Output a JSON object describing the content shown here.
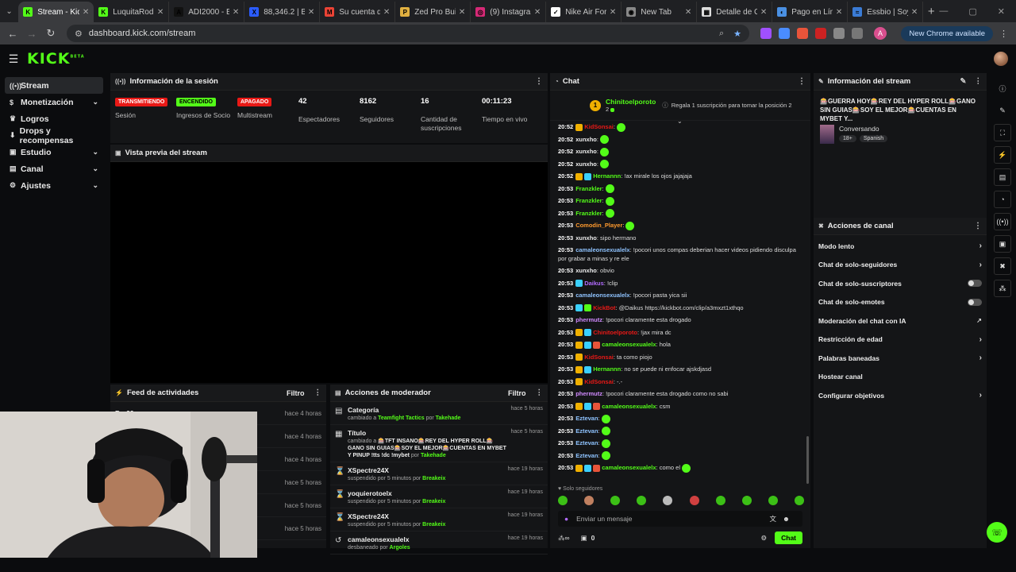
{
  "browser": {
    "tabs": [
      {
        "title": "Stream - Kick",
        "favicon": "#53fc18",
        "letter": "K",
        "active": true
      },
      {
        "title": "LuquitaRodri",
        "favicon": "#53fc18",
        "letter": "K"
      },
      {
        "title": "ADI2000 - BIN",
        "favicon": "#111111",
        "letter": "A"
      },
      {
        "title": "88,346.2 | BTC",
        "favicon": "#2b5cff",
        "letter": "X"
      },
      {
        "title": "Su cuenta de G",
        "favicon": "#ea4335",
        "letter": "M"
      },
      {
        "title": "Zed Pro Build",
        "favicon": "#e0b040",
        "letter": "P"
      },
      {
        "title": "(9) Instagram",
        "favicon": "#d62976",
        "letter": "◎"
      },
      {
        "title": "Nike Air Force",
        "favicon": "#ffffff",
        "letter": "✓"
      },
      {
        "title": "New Tab",
        "favicon": "#888888",
        "letter": "◉"
      },
      {
        "title": "Detalle de C",
        "favicon": "#dddddd",
        "letter": "▦"
      },
      {
        "title": "Pago en Línea",
        "favicon": "#4a90e2",
        "letter": "◐"
      },
      {
        "title": "Essbio | Soy",
        "favicon": "#3a7bd5",
        "letter": "≈"
      }
    ],
    "url": "dashboard.kick.com/stream",
    "new_chrome": "New Chrome available",
    "ext_colors": [
      "#a050ff",
      "#4a8cff",
      "#e8543a",
      "#cc2222",
      "#888888",
      "#777777"
    ],
    "profile_letter": "A"
  },
  "brand": {
    "logo": "KICK",
    "logo_sup": "BETA"
  },
  "sidebar": {
    "items": [
      {
        "label": "Stream",
        "icon": "((•))",
        "active": true,
        "chevron": false
      },
      {
        "label": "Monetización",
        "icon": "$",
        "chevron": true
      },
      {
        "label": "Logros",
        "icon": "♛",
        "chevron": false
      },
      {
        "label": "Drops y recompensas",
        "icon": "⬇",
        "chevron": false
      },
      {
        "label": "Estudio",
        "icon": "▣",
        "chevron": true
      },
      {
        "label": "Canal",
        "icon": "▤",
        "chevron": true
      },
      {
        "label": "Ajustes",
        "icon": "⚙",
        "chevron": true
      }
    ]
  },
  "session": {
    "title": "Información de la sesión",
    "stats": [
      {
        "badge": "TRANSMITIENDO",
        "kind": "red",
        "label": "Sesión"
      },
      {
        "badge": "ENCENDIDO",
        "kind": "green",
        "label": "Ingresos de Socio"
      },
      {
        "badge": "APAGADO",
        "kind": "red",
        "label": "Multistream"
      },
      {
        "value": "42",
        "label": "Espectadores"
      },
      {
        "value": "8162",
        "label": "Seguidores"
      },
      {
        "value": "16",
        "label": "Cantidad de suscripciones"
      },
      {
        "value": "00:11:23",
        "label": "Tiempo en vivo"
      }
    ]
  },
  "preview": {
    "title": "Vista previa del stream"
  },
  "feed": {
    "title": "Feed de actividades",
    "filter": "Filtro",
    "rows": [
      {
        "name": "Brc29",
        "time": "hace 4 horas"
      },
      {
        "name": "",
        "time": "hace 4 horas"
      },
      {
        "name": "",
        "time": "hace 4 horas"
      },
      {
        "name": "",
        "time": "hace 5 horas"
      },
      {
        "name": "",
        "time": "hace 5 horas"
      },
      {
        "name": "",
        "time": "hace 5 horas"
      }
    ]
  },
  "mod": {
    "title": "Acciones de moderador",
    "filter": "Filtro",
    "rows": [
      {
        "icon": "▤",
        "title": "Categoría",
        "pre": "cambiado a ",
        "hl": "Teamfight Tactics",
        "mid": " por ",
        "by": "Takehade",
        "time": "hace 5 horas"
      },
      {
        "icon": "▦",
        "title": "Título",
        "pre": "cambiado a ",
        "hl": "🎰TFT INSANO🎰REY DEL HYPER ROLL🎰GANO SIN GUIAS🎰SOY EL MEJOR🎰CUENTAS EN MYBET Y PINUP !tts !dc !mybet",
        "mid": " por ",
        "by": "Takehade",
        "time": "hace 5 horas"
      },
      {
        "icon": "⌛",
        "title": "XSpectre24X",
        "pre": "suspendido por 5 minutos por ",
        "hl": "",
        "mid": "",
        "by": "Breakeix",
        "time": "hace 19 horas"
      },
      {
        "icon": "⌛",
        "title": "yoquierotoelx",
        "pre": "suspendido por 5 minutos por ",
        "hl": "",
        "mid": "",
        "by": "Breakeix",
        "time": "hace 19 horas"
      },
      {
        "icon": "⌛",
        "title": "XSpectre24X",
        "pre": "suspendido por 5 minutos por ",
        "hl": "",
        "mid": "",
        "by": "Breakeix",
        "time": "hace 19 horas"
      },
      {
        "icon": "↺",
        "title": "camaleonsexualelx",
        "pre": "desbaneado por ",
        "hl": "",
        "mid": "",
        "by": "Argoles",
        "time": "hace 19 horas"
      }
    ]
  },
  "chat": {
    "title": "Chat",
    "pinned_user": "Chinitoelporoto",
    "pinned_count": "2",
    "pinned_coin": "1",
    "pinned_text": "Regala 1 suscripción para tomar la posición 2",
    "solo": "Solo seguidores",
    "placeholder": "Enviar un mensaje",
    "footer_count": "0",
    "send": "Chat",
    "messages": [
      {
        "t": "20:52",
        "u": "KidSonsai",
        "c": "#e91916",
        "text": ":",
        "emo": 1,
        "badges": [
          "#f0b000"
        ]
      },
      {
        "t": "20:52",
        "u": "xunxho",
        "c": "#eeeeee",
        "text": ":",
        "emo": 1
      },
      {
        "t": "20:52",
        "u": "xunxho",
        "c": "#eeeeee",
        "text": ":",
        "emo": 1
      },
      {
        "t": "20:52",
        "u": "xunxho",
        "c": "#eeeeee",
        "text": ":",
        "emo": 1
      },
      {
        "t": "20:52",
        "u": "Hernannn",
        "c": "#53fc18",
        "text": ": !ax mirale los ojos jajajaja",
        "badges": [
          "#f0b000",
          "#3ad0ff"
        ]
      },
      {
        "t": "20:53",
        "u": "Franzkler",
        "c": "#53fc18",
        "text": ":",
        "emo": 1
      },
      {
        "t": "20:53",
        "u": "Franzkler",
        "c": "#53fc18",
        "text": ":",
        "emo": 1
      },
      {
        "t": "20:53",
        "u": "Franzkler",
        "c": "#53fc18",
        "text": ":",
        "emo": 1
      },
      {
        "t": "20:53",
        "u": "Comodin_Player",
        "c": "#ff9a2e",
        "text": ":",
        "emo": 1
      },
      {
        "t": "20:53",
        "u": "xunxho",
        "c": "#eeeeee",
        "text": ": sipo hermano"
      },
      {
        "t": "20:53",
        "u": "camaleonsexualelx",
        "c": "#8fc3ff",
        "text": ": !pocori unos compas deberian hacer videos pidiendo disculpa por grabar a minas y re ele",
        "wrap": true
      },
      {
        "t": "20:53",
        "u": "xunxho",
        "c": "#eeeeee",
        "text": ": obvio"
      },
      {
        "t": "20:53",
        "u": "Daikus",
        "c": "#b26bff",
        "text": ": !clip",
        "badges": [
          "#3ad0ff"
        ]
      },
      {
        "t": "20:53",
        "u": "camaleonsexualelx",
        "c": "#8fc3ff",
        "text": ": !pocori pasta yica sii"
      },
      {
        "t": "20:53",
        "u": "KickBot",
        "c": "#e91916",
        "text": ": @Daikus https://kickbot.com/clip/a3mxzt1xthqo",
        "badges": [
          "#3ad0ff",
          "#53fc18"
        ]
      },
      {
        "t": "20:53",
        "u": "phermutz",
        "c": "#d18bff",
        "text": ": !pocori claramente esta drogado"
      },
      {
        "t": "20:53",
        "u": "Chinitoelporoto",
        "c": "#e91916",
        "text": ": !jax mira dc",
        "badges": [
          "#f0b000",
          "#3ad0ff"
        ]
      },
      {
        "t": "20:53",
        "u": "camaleonsexualelx",
        "c": "#53fc18",
        "text": ": hola",
        "badges": [
          "#f0b000",
          "#3ad0ff",
          "#e8543a"
        ]
      },
      {
        "t": "20:53",
        "u": "KidSonsai",
        "c": "#e91916",
        "text": ": ta como piojo",
        "badges": [
          "#f0b000"
        ]
      },
      {
        "t": "20:53",
        "u": "Hernannn",
        "c": "#53fc18",
        "text": ": no se puede ni enfocar ajskdjasd",
        "badges": [
          "#f0b000",
          "#3ad0ff"
        ]
      },
      {
        "t": "20:53",
        "u": "KidSonsai",
        "c": "#e91916",
        "text": ": -.-",
        "badges": [
          "#f0b000"
        ]
      },
      {
        "t": "20:53",
        "u": "phermutz",
        "c": "#d18bff",
        "text": ": !pocori claramente esta drogado como no sabi"
      },
      {
        "t": "20:53",
        "u": "camaleonsexualelx",
        "c": "#53fc18",
        "text": ": csm",
        "badges": [
          "#f0b000",
          "#3ad0ff",
          "#e8543a"
        ]
      },
      {
        "t": "20:53",
        "u": "Eztevan",
        "c": "#8fc3ff",
        "text": ":",
        "emo": 1
      },
      {
        "t": "20:53",
        "u": "Eztevan",
        "c": "#8fc3ff",
        "text": ":",
        "emo": 1
      },
      {
        "t": "20:53",
        "u": "Eztevan",
        "c": "#8fc3ff",
        "text": ":",
        "emo": 1
      },
      {
        "t": "20:53",
        "u": "Eztevan",
        "c": "#8fc3ff",
        "text": ":",
        "emo": 1
      },
      {
        "t": "20:53",
        "u": "camaleonsexualelx",
        "c": "#53fc18",
        "text": ": como el",
        "emo": 1,
        "badges": [
          "#f0b000",
          "#3ad0ff",
          "#e8543a"
        ]
      }
    ]
  },
  "info": {
    "title": "Información del stream",
    "stream_title": "🎰GUERRA HOY🎰REY DEL HYPER ROLL🎰GANO SIN GUIAS🎰SOY EL MEJOR🎰CUENTAS EN MYBET Y...",
    "category": "Conversando",
    "tags": [
      "18+",
      "Spanish"
    ]
  },
  "actions": {
    "title": "Acciones de canal",
    "rows": [
      {
        "label": "Modo lento",
        "ctl": "chev"
      },
      {
        "label": "Chat de solo-seguidores",
        "ctl": "chev"
      },
      {
        "label": "Chat de solo-suscriptores",
        "ctl": "toggle"
      },
      {
        "label": "Chat de solo-emotes",
        "ctl": "toggle"
      },
      {
        "label": "Moderación del chat con IA",
        "ctl": "ext"
      },
      {
        "label": "Restricción de edad",
        "ctl": "chev"
      },
      {
        "label": "Palabras baneadas",
        "ctl": "chev"
      },
      {
        "label": "Hostear canal",
        "ctl": "none"
      },
      {
        "label": "Configurar objetivos",
        "ctl": "chev"
      }
    ]
  },
  "rail": {
    "icons": [
      "ⓘ",
      "✎",
      "⛶",
      "⚡",
      "▤",
      "◔",
      "((•))",
      "▣",
      "✖",
      "⁂"
    ]
  }
}
